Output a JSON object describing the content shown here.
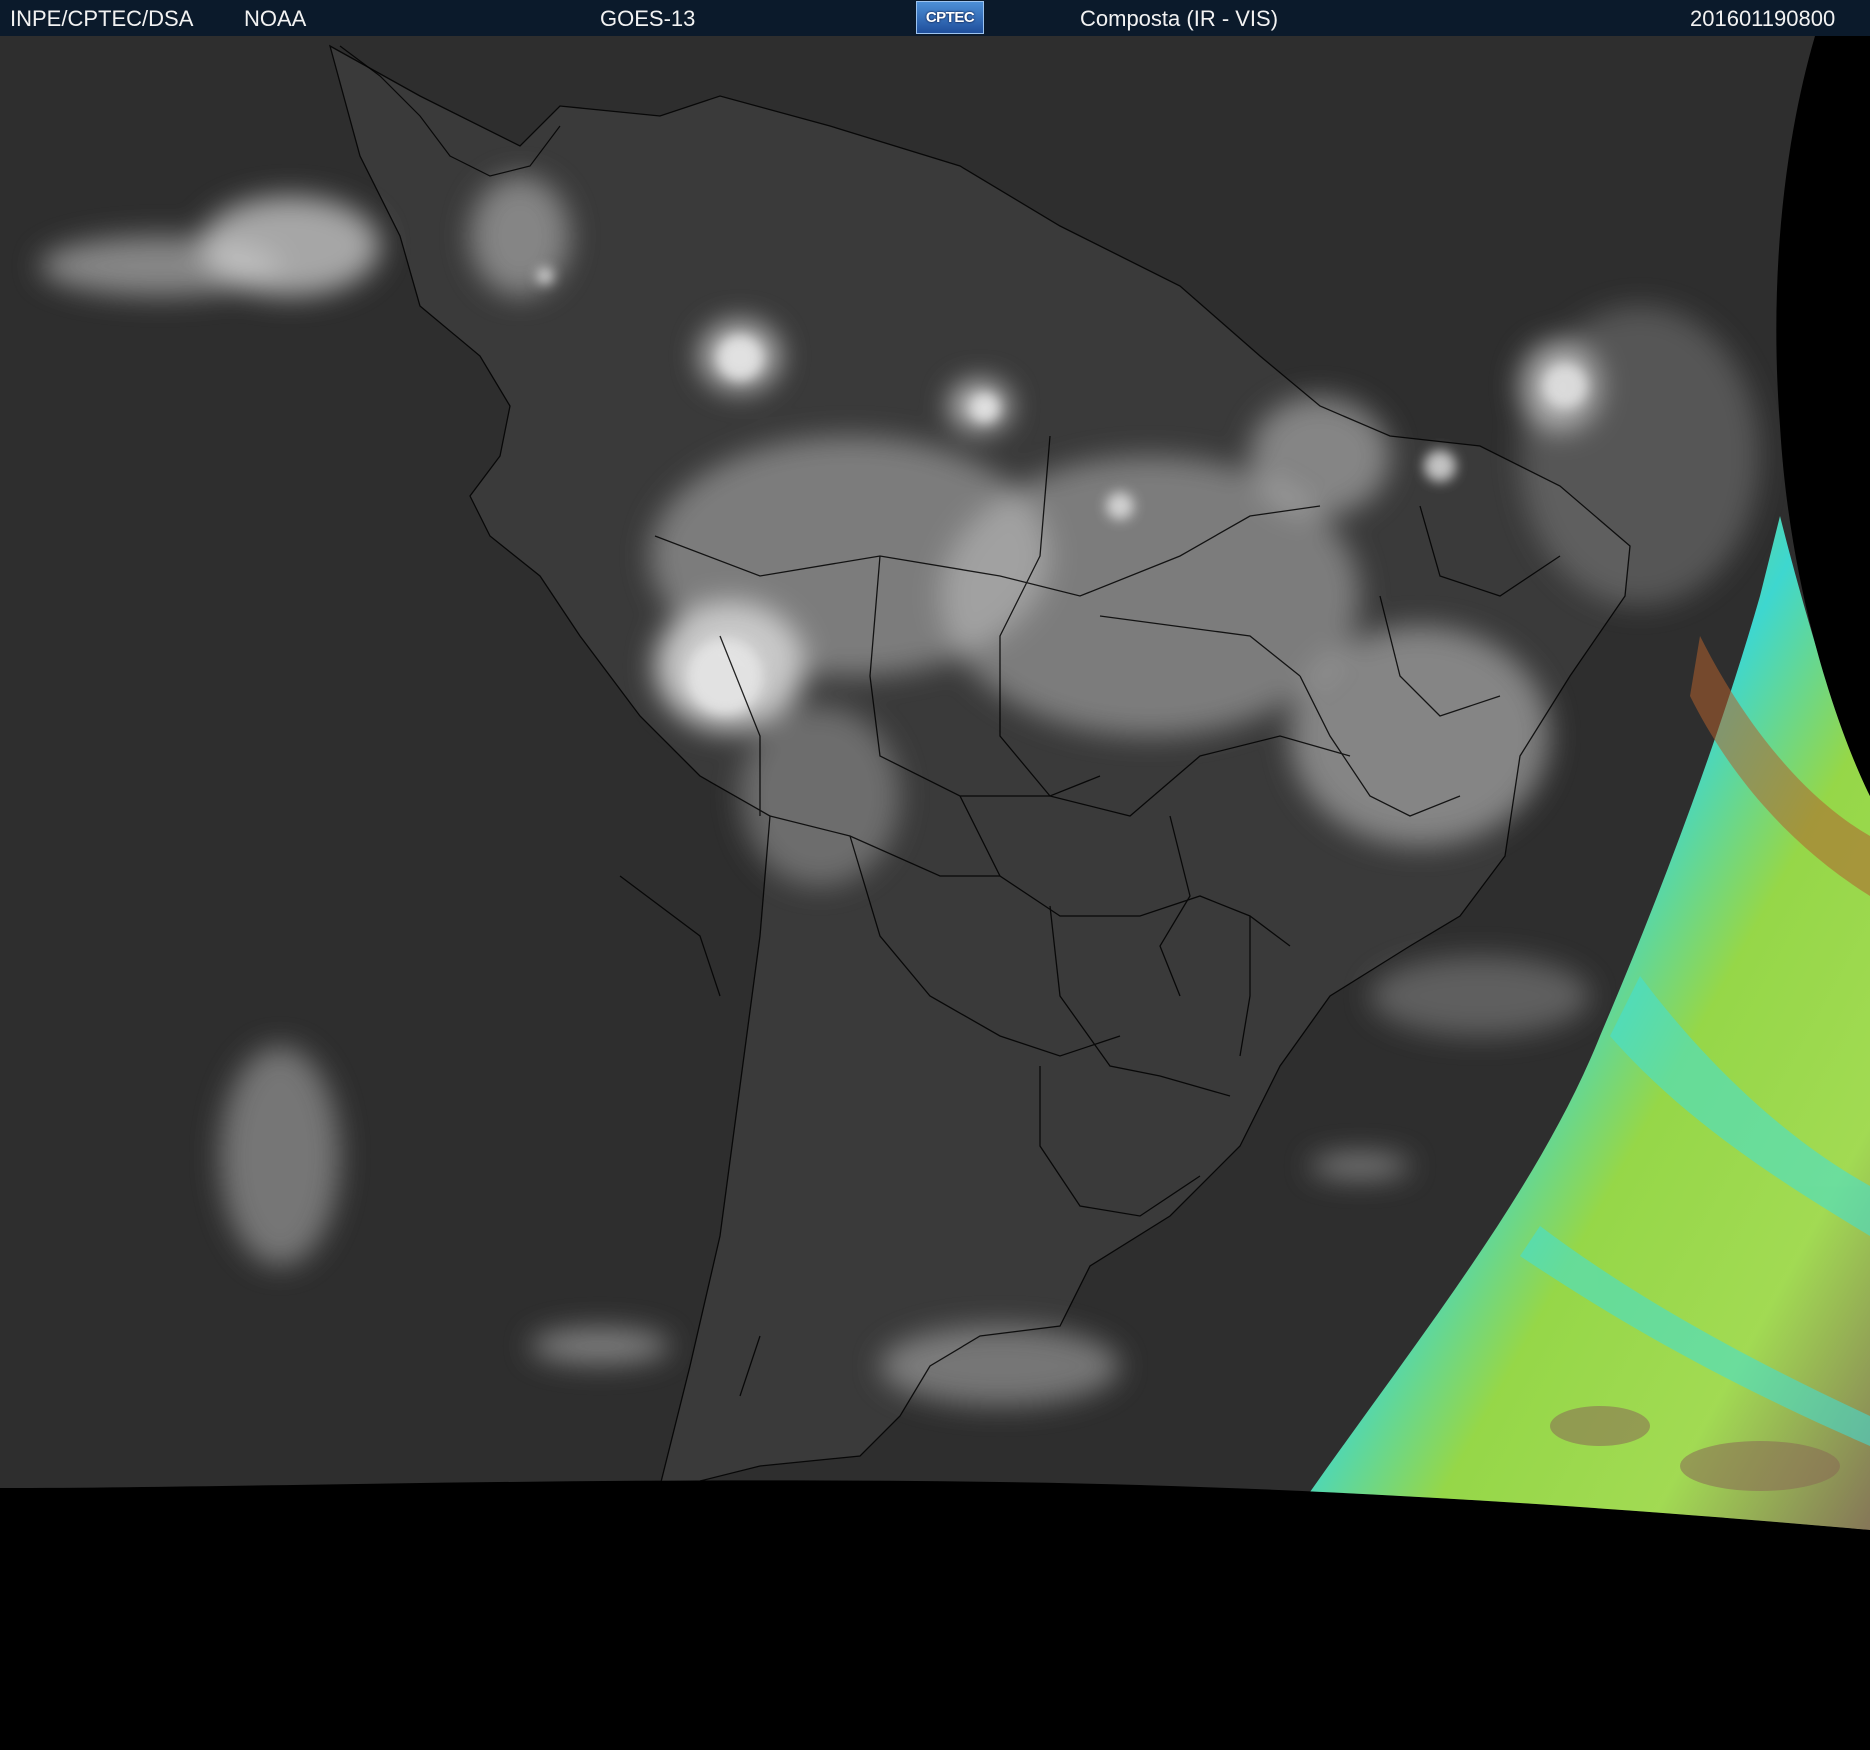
{
  "header": {
    "agency": "INPE/CPTEC/DSA",
    "source": "NOAA",
    "satellite": "GOES-13",
    "logo_text": "CPTEC",
    "product": "Composta (IR - VIS)",
    "timestamp": "201601190800"
  },
  "colors": {
    "header_bg": "#0b1a2b",
    "space": "#000000",
    "ocean_ir": "#2f2f2f",
    "land_ir": "#3a3a3a",
    "cloud": "#c8c8c8",
    "border_lines": "#000000",
    "vis_green": "#9be04a",
    "vis_cyan": "#3fe0d8",
    "vis_brown": "#9a6a4a"
  }
}
